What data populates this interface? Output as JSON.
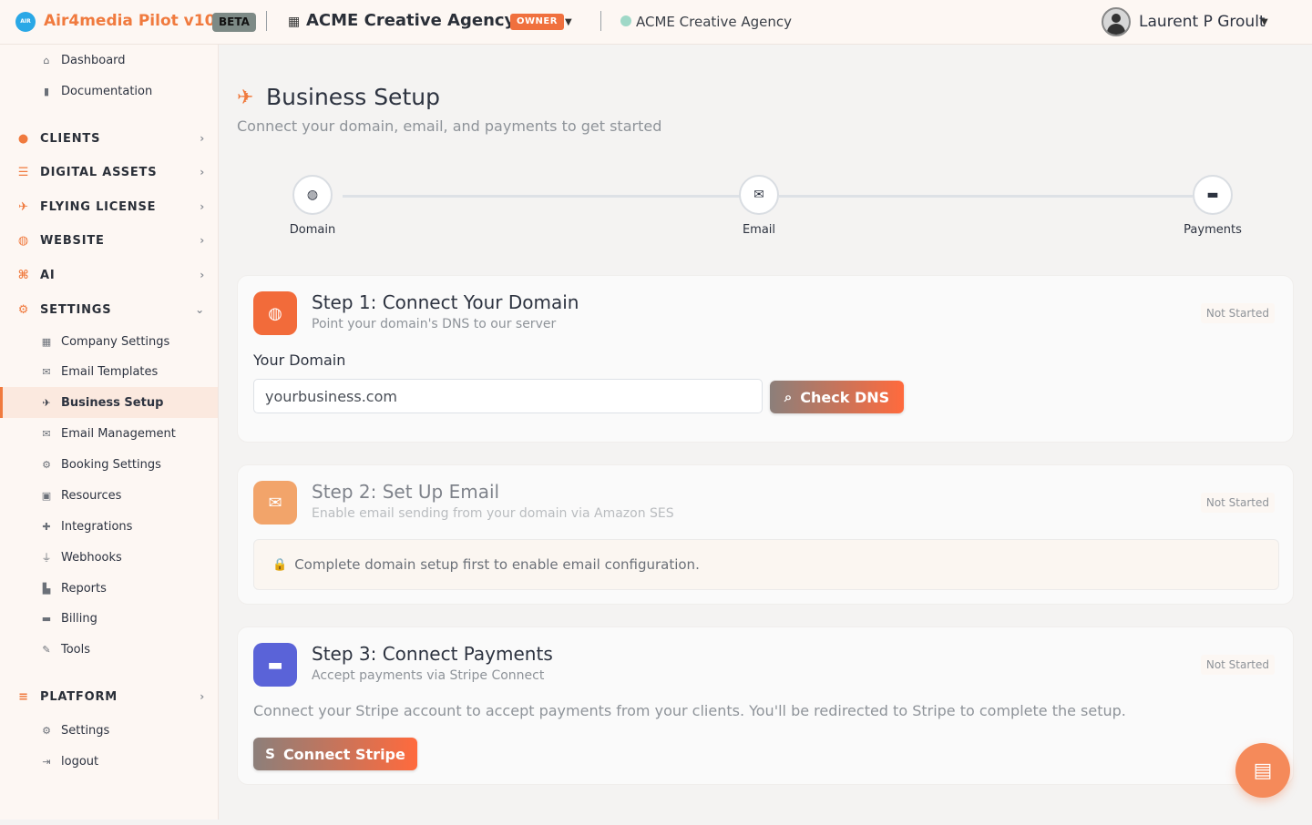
{
  "topbar": {
    "logo_text": "AIR",
    "brand": "Air4media Pilot v10",
    "beta": "BETA",
    "org_name": "ACME Creative Agency",
    "owner_badge": "OWNER",
    "site_name": "ACME Creative Agency",
    "user_name": "Laurent P Groult"
  },
  "sidebar": {
    "items": [
      {
        "label": "Dashboard",
        "icon": "home-icon",
        "glyph": "⌂"
      },
      {
        "label": "Documentation",
        "icon": "book-icon",
        "glyph": "▮"
      }
    ],
    "sections": [
      {
        "label": "CLIENTS",
        "icon": "users-icon",
        "glyph": "👥"
      },
      {
        "label": "DIGITAL ASSETS",
        "icon": "database-icon",
        "glyph": "☰"
      },
      {
        "label": "FLYING LICENSE",
        "icon": "rocket-icon",
        "glyph": "✈"
      },
      {
        "label": "WEBSITE",
        "icon": "globe-icon",
        "glyph": "◍"
      },
      {
        "label": "AI",
        "icon": "robot-icon",
        "glyph": "⌘"
      },
      {
        "label": "SETTINGS",
        "icon": "gear-icon",
        "glyph": "⚙"
      },
      {
        "label": "PLATFORM",
        "icon": "server-icon",
        "glyph": "≡"
      }
    ],
    "settings_items": [
      {
        "label": "Company Settings",
        "icon": "building-icon",
        "glyph": "▦"
      },
      {
        "label": "Email Templates",
        "icon": "envelope-open-icon",
        "glyph": "✉"
      },
      {
        "label": "Business Setup",
        "icon": "rocket-icon",
        "glyph": "✈"
      },
      {
        "label": "Email Management",
        "icon": "envelope-icon",
        "glyph": "✉"
      },
      {
        "label": "Booking Settings",
        "icon": "gear-icon",
        "glyph": "⚙"
      },
      {
        "label": "Resources",
        "icon": "toolbox-icon",
        "glyph": "▣"
      },
      {
        "label": "Integrations",
        "icon": "puzzle-icon",
        "glyph": "✚"
      },
      {
        "label": "Webhooks",
        "icon": "plug-icon",
        "glyph": "⏚"
      },
      {
        "label": "Reports",
        "icon": "chart-icon",
        "glyph": "▙"
      },
      {
        "label": "Billing",
        "icon": "credit-card-icon",
        "glyph": "▬"
      },
      {
        "label": "Tools",
        "icon": "tools-icon",
        "glyph": "✎"
      }
    ],
    "platform_items": [
      {
        "label": "Settings",
        "icon": "gear-icon",
        "glyph": "⚙"
      },
      {
        "label": "logout",
        "icon": "logout-icon",
        "glyph": "⇥"
      }
    ]
  },
  "main": {
    "title": "Business Setup",
    "subtitle": "Connect your domain, email, and payments to get started",
    "steps": [
      {
        "label": "Domain",
        "icon": "globe-icon"
      },
      {
        "label": "Email",
        "icon": "envelope-icon"
      },
      {
        "label": "Payments",
        "icon": "credit-card-icon"
      }
    ],
    "step1": {
      "title": "Step 1: Connect Your Domain",
      "subtitle": "Point your domain's DNS to our server",
      "status": "Not Started",
      "field_label": "Your Domain",
      "domain_value": "yourbusiness.com",
      "button": "Check DNS"
    },
    "step2": {
      "title": "Step 2: Set Up Email",
      "subtitle": "Enable email sending from your domain via Amazon SES",
      "status": "Not Started",
      "notice": "Complete domain setup first to enable email configuration."
    },
    "step3": {
      "title": "Step 3: Connect Payments",
      "subtitle": "Accept payments via Stripe Connect",
      "status": "Not Started",
      "description": "Connect your Stripe account to accept payments from your clients. You'll be redirected to Stripe to complete the setup.",
      "button": "Connect Stripe"
    }
  },
  "colors": {
    "accent": "#f07a3e",
    "step1_icon_bg": "#f26b3a",
    "step2_icon_bg": "#f2a46a",
    "step3_icon_bg": "#5a63d8"
  }
}
